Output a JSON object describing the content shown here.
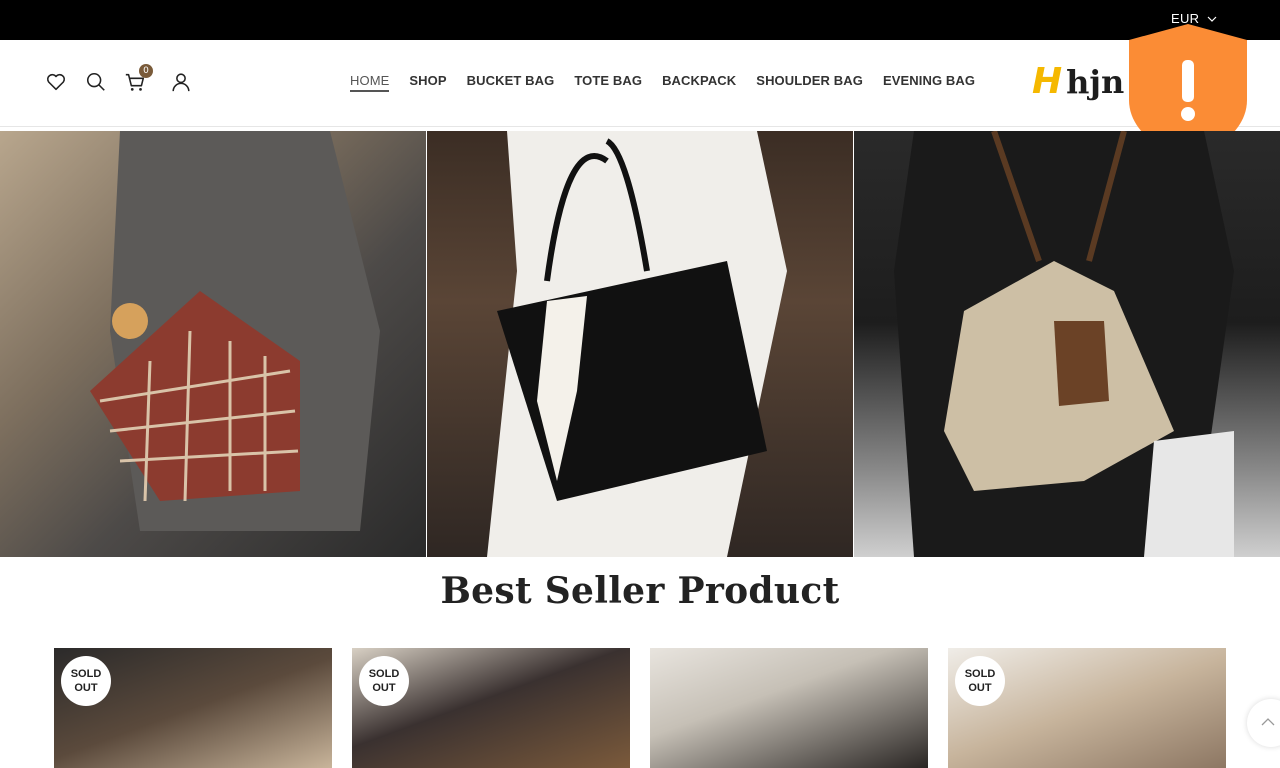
{
  "topbar": {
    "currency": "EUR",
    "currency_icon": "chevron-down-icon"
  },
  "header": {
    "cart_count": "0",
    "icons": [
      "heart-icon",
      "search-icon",
      "cart-icon",
      "user-icon"
    ],
    "nav": [
      {
        "label": "HOME",
        "active": true
      },
      {
        "label": "SHOP",
        "active": false
      },
      {
        "label": "BUCKET BAG",
        "active": false
      },
      {
        "label": "TOTE BAG",
        "active": false
      },
      {
        "label": "BACKPACK",
        "active": false
      },
      {
        "label": "SHOULDER BAG",
        "active": false
      },
      {
        "label": "EVENING BAG",
        "active": false
      }
    ],
    "logo_mark": "H",
    "logo_text": "hjn",
    "logo_colors": {
      "mark": "#f5b800",
      "text": "#1d1d1d"
    }
  },
  "alert_badge": {
    "symbol": "!",
    "color": "#fb8c35"
  },
  "section": {
    "title": "Best Seller Product"
  },
  "products": [
    {
      "sold_line1": "SOLD",
      "sold_line2": "OUT",
      "sold_out": true
    },
    {
      "sold_line1": "SOLD",
      "sold_line2": "OUT",
      "sold_out": true
    },
    {
      "sold_line1": "",
      "sold_line2": "",
      "sold_out": false
    },
    {
      "sold_line1": "SOLD",
      "sold_line2": "OUT",
      "sold_out": true
    }
  ],
  "colors": {
    "topbar": "#000000",
    "accent": "#7a5b3a"
  }
}
